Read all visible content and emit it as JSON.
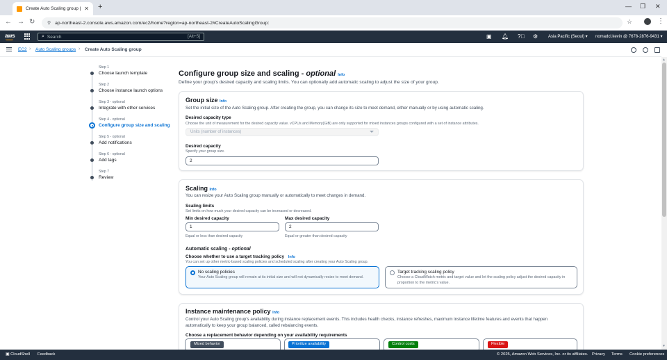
{
  "browser": {
    "tab_title": "Create Auto Scaling group | E",
    "url": "ap-northeast-2.console.aws.amazon.com/ec2/home?region=ap-northeast-2#CreateAutoScalingGroup:"
  },
  "aws_header": {
    "logo": "aws",
    "search_placeholder": "Search",
    "search_shortcut": "[Alt+S]",
    "region": "Asia Pacific (Seoul) ▾",
    "account": "nomadcl.kevin @ 7678-2876-9431 ▾"
  },
  "breadcrumb": [
    "EC2",
    "Auto Scaling groups",
    "Create Auto Scaling group"
  ],
  "steps": [
    {
      "label": "Step 1",
      "title": "Choose launch template"
    },
    {
      "label": "Step 2",
      "title": "Choose instance launch options"
    },
    {
      "label": "Step 3 - optional",
      "title": "Integrate with other services"
    },
    {
      "label": "Step 4 - optional",
      "title": "Configure group size and scaling"
    },
    {
      "label": "Step 5 - optional",
      "title": "Add notifications"
    },
    {
      "label": "Step 6 - optional",
      "title": "Add tags"
    },
    {
      "label": "Step 7",
      "title": "Review"
    }
  ],
  "page": {
    "title": "Configure group size and scaling -",
    "title_optional": "optional",
    "info": "Info",
    "description": "Define your group's desired capacity and scaling limits. You can optionally add automatic scaling to adjust the size of your group."
  },
  "group_size": {
    "title": "Group size",
    "info": "Info",
    "description": "Set the initial size of the Auto Scaling group. After creating the group, you can change its size to meet demand, either manually or by using automatic scaling.",
    "capacity_type_label": "Desired capacity type",
    "capacity_type_hint": "Choose the unit of measurement for the desired capacity value. vCPUs and Memory(GiB) are only supported for mixed instances groups configured with a set of instance attributes.",
    "capacity_type_value": "Units (number of instances)",
    "desired_label": "Desired capacity",
    "desired_hint": "Specify your group size.",
    "desired_value": "2"
  },
  "scaling": {
    "title": "Scaling",
    "info": "Info",
    "description": "You can resize your Auto Scaling group manually or automatically to meet changes in demand.",
    "limits_label": "Scaling limits",
    "limits_hint": "Set limits on how much your desired capacity can be increased or decreased.",
    "min_label": "Min desired capacity",
    "min_value": "1",
    "min_hint": "Equal or less than desired capacity",
    "max_label": "Max desired capacity",
    "max_value": "2",
    "max_hint": "Equal or greater than desired capacity",
    "auto_label": "Automatic scaling -",
    "auto_optional": "optional",
    "tracking_label": "Choose whether to use a target tracking policy",
    "tracking_info": "Info",
    "tracking_hint": "You can set up other metric-based scaling policies and scheduled scaling after creating your Auto Scaling group.",
    "options": [
      {
        "title": "No scaling policies",
        "desc": "Your Auto Scaling group will remain at its initial size and will not dynamically resize to meet demand."
      },
      {
        "title": "Target tracking scaling policy",
        "desc": "Choose a CloudWatch metric and target value and let the scaling policy adjust the desired capacity in proportion to the metric's value."
      }
    ]
  },
  "maintenance": {
    "title": "Instance maintenance policy",
    "info": "Info",
    "description": "Control your Auto Scaling group's availability during instance replacement events. This includes health checks, instance refreshes, maximum instance lifetime features and events that happen automatically to keep your group balanced, called rebalancing events.",
    "behavior_label": "Choose a replacement behavior depending on your availability requirements",
    "badges": [
      "Mixed behavior",
      "Prioritize availability",
      "Control costs",
      "Flexible"
    ],
    "badge_colors": [
      "#414d5c",
      "#0972d3",
      "#037f0c",
      "#d91515"
    ]
  },
  "footer": {
    "cloudshell": "CloudShell",
    "feedback": "Feedback",
    "copyright": "© 2025, Amazon Web Services, Inc. or its affiliates.",
    "privacy": "Privacy",
    "terms": "Terms",
    "cookies": "Cookie preferences"
  }
}
